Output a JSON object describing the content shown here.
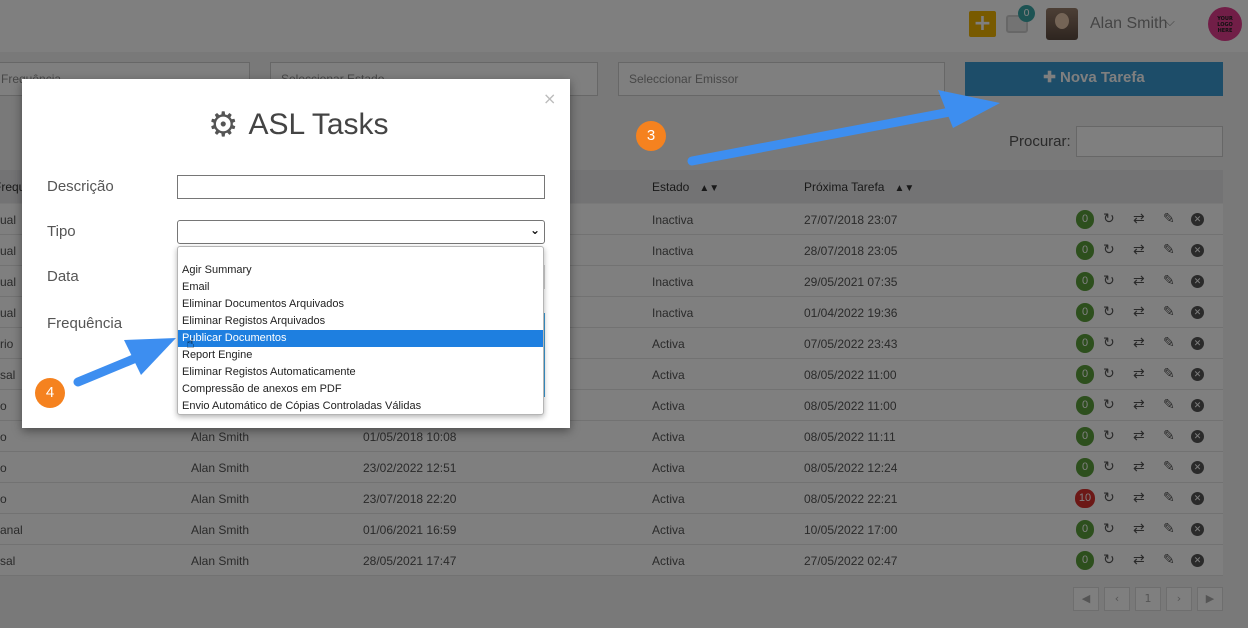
{
  "topbar": {
    "plus_icon": "plus-icon",
    "inbox_count": "0",
    "user_name": "Alan Smith",
    "logo_text": "YOUR LOGO HERE"
  },
  "filters": {
    "frequency_placeholder": "Frequência",
    "state_placeholder": "Seleccionar Estado",
    "emitter_placeholder": "Seleccionar Emissor",
    "new_task_label": "Nova Tarefa",
    "search_label": "Procurar:"
  },
  "table": {
    "columns": [
      "Frequência",
      "Estado",
      "Próxima Tarefa"
    ],
    "rows": [
      {
        "freq": "ual",
        "user": "",
        "date": "",
        "state": "Inactiva",
        "next": "27/07/2018 23:07",
        "count": "0",
        "status": "ok"
      },
      {
        "freq": "ual",
        "user": "",
        "date": "",
        "state": "Inactiva",
        "next": "28/07/2018 23:05",
        "count": "0",
        "status": "ok"
      },
      {
        "freq": "ual",
        "user": "",
        "date": "",
        "state": "Inactiva",
        "next": "29/05/2021 07:35",
        "count": "0",
        "status": "ok"
      },
      {
        "freq": "ual",
        "user": "",
        "date": "",
        "state": "Inactiva",
        "next": "01/04/2022 19:36",
        "count": "0",
        "status": "ok"
      },
      {
        "freq": "rio",
        "user": "",
        "date": "",
        "state": "Activa",
        "next": "07/05/2022 23:43",
        "count": "0",
        "status": "ok"
      },
      {
        "freq": "sal",
        "user": "",
        "date": "",
        "state": "Activa",
        "next": "08/05/2022 11:00",
        "count": "0",
        "status": "ok"
      },
      {
        "freq": "o",
        "user": "",
        "date": "",
        "state": "Activa",
        "next": "08/05/2022 11:00",
        "count": "0",
        "status": "ok"
      },
      {
        "freq": "o",
        "user": "Alan Smith",
        "date": "01/05/2018 10:08",
        "state": "Activa",
        "next": "08/05/2022 11:11",
        "count": "0",
        "status": "ok"
      },
      {
        "freq": "o",
        "user": "Alan Smith",
        "date": "23/02/2022 12:51",
        "state": "Activa",
        "next": "08/05/2022 12:24",
        "count": "0",
        "status": "ok"
      },
      {
        "freq": "o",
        "user": "Alan Smith",
        "date": "23/07/2018 22:20",
        "state": "Activa",
        "next": "08/05/2022 22:21",
        "count": "10",
        "status": "error"
      },
      {
        "freq": "anal",
        "user": "Alan Smith",
        "date": "01/06/2021 16:59",
        "state": "Activa",
        "next": "10/05/2022 17:00",
        "count": "0",
        "status": "ok"
      },
      {
        "freq": "sal",
        "user": "Alan Smith",
        "date": "28/05/2021 17:47",
        "state": "Activa",
        "next": "27/05/2022 02:47",
        "count": "0",
        "status": "ok"
      }
    ],
    "pager": [
      "◀",
      "‹",
      "1",
      "›",
      "▶"
    ]
  },
  "colors": {
    "ok_badge": "#5a9e3a",
    "error_badge": "#d9302c",
    "accent": "#3b9bd3",
    "step": "#f5821f",
    "arrow": "#3d8ef0"
  },
  "modal": {
    "title": "ASL Tasks",
    "close": "×",
    "labels": {
      "descricao": "Descrição",
      "tipo": "Tipo",
      "data": "Data",
      "frequencia": "Frequência"
    },
    "options": [
      "",
      "Agir Summary",
      "Email",
      "Eliminar Documentos Arquivados",
      "Eliminar Registos Arquivados",
      "Publicar Documentos",
      "Report Engine",
      "Eliminar Registos Automaticamente",
      "Compressão de anexos em PDF",
      "Envio Automático de Cópias Controladas Válidas"
    ],
    "selected_option": "Publicar Documentos"
  },
  "annotations": {
    "step3": "3",
    "step4": "4"
  }
}
